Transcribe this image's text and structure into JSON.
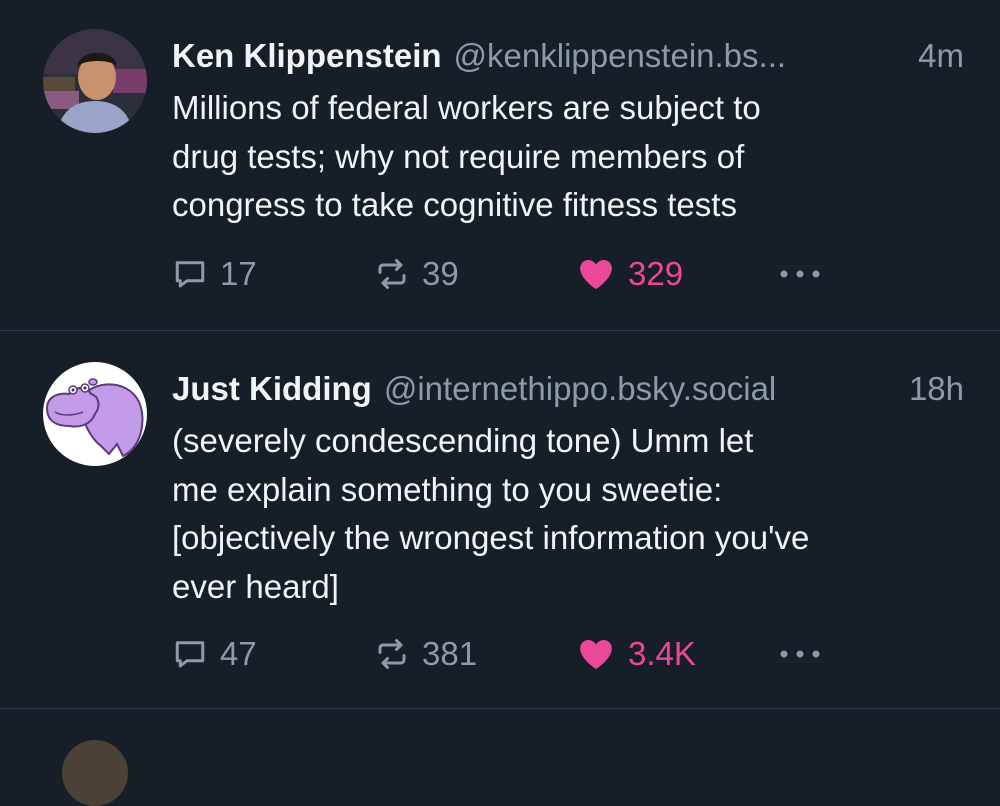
{
  "posts": [
    {
      "author": {
        "display_name": "Ken Klippenstein",
        "handle": "@kenklippenstein.bs...",
        "avatar_icon": "person-photo-avatar"
      },
      "time": "4m",
      "text_lines": [
        "Millions of federal workers are subject to",
        "drug tests; why not require members of",
        "congress to take cognitive fitness tests"
      ],
      "stats": {
        "replies": "17",
        "reposts": "39",
        "likes": "329"
      }
    },
    {
      "author": {
        "display_name": "Just Kidding",
        "handle": "@internethippo.bsky.social",
        "avatar_icon": "hippo-avatar"
      },
      "time": "18h",
      "text_lines": [
        "(severely condescending tone) Umm let",
        "me explain something to you sweetie:",
        "[objectively the wrongest information you've",
        "ever heard]"
      ],
      "stats": {
        "replies": "47",
        "reposts": "381",
        "likes": "3.4K"
      }
    }
  ],
  "icons": {
    "reply": "speech-bubble-icon",
    "repost": "repost-arrows-icon",
    "like": "heart-icon",
    "more": "more-dots-icon"
  },
  "colors": {
    "background": "#161e27",
    "primary_text": "#f1f3f5",
    "secondary_text": "#8d9aa8",
    "like_pink": "#ec4899",
    "divider": "#2e3a46"
  }
}
